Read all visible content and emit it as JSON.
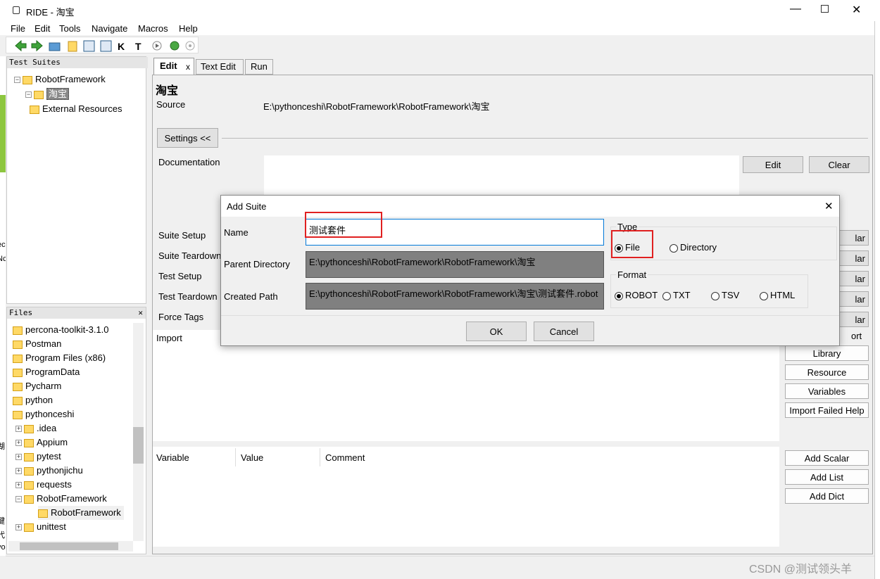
{
  "window": {
    "title": "RIDE - 淘宝"
  },
  "menu": [
    "File",
    "Edit",
    "Tools",
    "Navigate",
    "Macros",
    "Help"
  ],
  "toolbar_icons": [
    "arrow-left-icon",
    "arrow-right-icon",
    "open-folder-icon",
    "new-folder-icon",
    "save-icon",
    "save-all-icon",
    "k-icon",
    "t-icon",
    "play-icon",
    "debug-icon",
    "stop-icon"
  ],
  "test_suites": {
    "header": "Test Suites",
    "root": "RobotFramework",
    "child": "淘宝",
    "external": "External Resources"
  },
  "files": {
    "header": "Files",
    "close": "✕",
    "items": [
      "percona-toolkit-3.1.0",
      "Postman",
      "Program Files (x86)",
      "ProgramData",
      "Pycharm",
      "python",
      "pythonceshi"
    ],
    "sub_items": [
      ".idea",
      "Appium",
      "pytest",
      "pythonjichu",
      "requests",
      "RobotFramework"
    ],
    "nested": "RobotFramework",
    "after": "unittest"
  },
  "tabs": [
    "Edit",
    "Text Edit",
    "Run"
  ],
  "tab_close": "x",
  "editor": {
    "title": "淘宝",
    "source_label": "Source",
    "source_value": "E:\\pythonceshi\\RobotFramework\\RobotFramework\\淘宝",
    "settings_button": "Settings <<",
    "documentation_label": "Documentation",
    "edit_button": "Edit",
    "clear_button": "Clear",
    "setting_labels": [
      "Suite Setup",
      "Suite Teardown",
      "Test Setup",
      "Test Teardown",
      "Force Tags"
    ],
    "right_buttons_partial": [
      "lar",
      "lar",
      "lar",
      "lar",
      "lar",
      "ort"
    ],
    "import_label": "Import",
    "import_buttons": [
      "Library",
      "Resource",
      "Variables",
      "Import Failed Help"
    ],
    "variable_columns": [
      "Variable",
      "Value",
      "Comment"
    ],
    "variable_buttons": [
      "Add Scalar",
      "Add List",
      "Add Dict"
    ]
  },
  "dialog": {
    "title": "Add Suite",
    "close": "✕",
    "name_label": "Name",
    "name_value": "测试套件",
    "parent_label": "Parent Directory",
    "parent_value": "E:\\pythonceshi\\RobotFramework\\RobotFramework\\淘宝",
    "created_label": "Created Path",
    "created_value": "E:\\pythonceshi\\RobotFramework\\RobotFramework\\淘宝\\测试套件.robot",
    "type_label": "Type",
    "type_options": [
      "File",
      "Directory"
    ],
    "type_selected": "File",
    "format_label": "Format",
    "format_options": [
      "ROBOT",
      "TXT",
      "TSV",
      "HTML"
    ],
    "format_selected": "ROBOT",
    "ok": "OK",
    "cancel": "Cancel"
  },
  "left_edge_fragments": [
    "ec",
    "Nc",
    "湖",
    "键",
    "代",
    "vo"
  ],
  "watermark": "CSDN @测试领头羊"
}
